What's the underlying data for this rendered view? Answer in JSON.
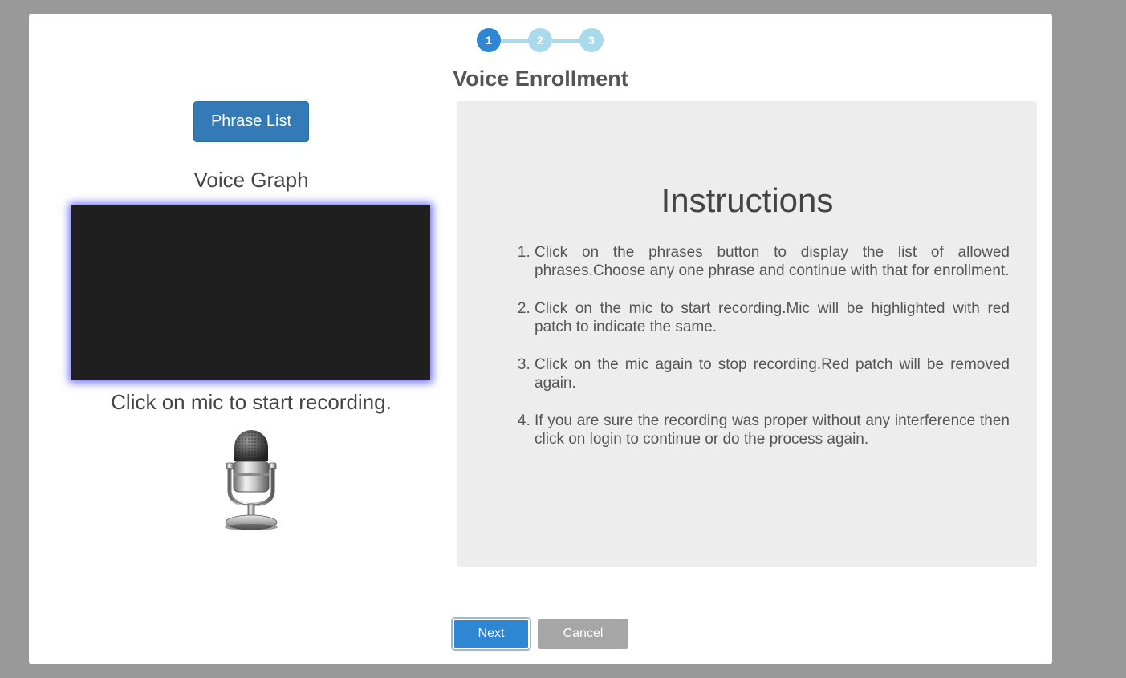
{
  "stepper": {
    "steps": [
      "1",
      "2",
      "3"
    ],
    "active_step": 1
  },
  "title": "Voice Enrollment",
  "left": {
    "phrase_button_label": "Phrase List",
    "voice_graph_label": "Voice Graph",
    "mic_hint": "Click on mic to start recording.",
    "mic_icon": "microphone-icon"
  },
  "instructions": {
    "title": "Instructions",
    "items": [
      "Click on the phrases button to display the list of allowed phrases.Choose any one phrase and continue with that for enrollment.",
      "Click on the mic to start recording.Mic will be highlighted with red patch to indicate the same.",
      "Click on the mic again to stop recording.Red patch will be removed again.",
      "If you are sure the recording was proper without any interference then click on login to continue or do the process again."
    ]
  },
  "footer": {
    "next_label": "Next",
    "cancel_label": "Cancel"
  },
  "colors": {
    "primary": "#2f86d3",
    "step_inactive": "#a9dae9",
    "panel_bg": "#ededed",
    "overlay": "#999999",
    "graph_bg": "#1f1f1f",
    "graph_glow": "#6f6ff5"
  }
}
